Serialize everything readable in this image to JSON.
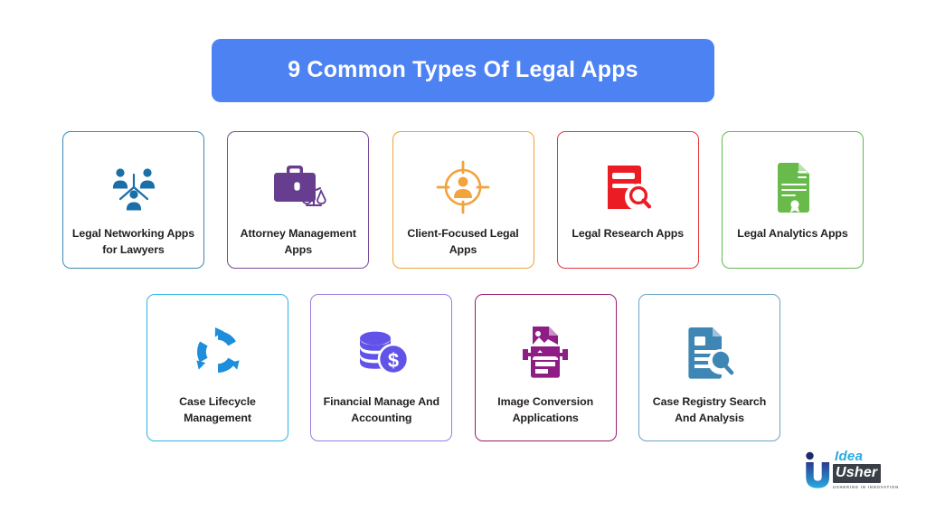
{
  "title": {
    "text": "9 Common Types Of Legal Apps",
    "background_color": "#4d82f3",
    "text_color": "#ffffff"
  },
  "rows": [
    {
      "id": "row-1",
      "cards": [
        {
          "label": "Legal Networking Apps for Lawyers",
          "icon": "people-network-icon",
          "border_color": "#3b8ab5",
          "icon_color": "#1a6fa8"
        },
        {
          "label": "Attorney Management Apps",
          "icon": "briefcase-scales-icon",
          "border_color": "#7a4a97",
          "icon_color": "#663d8f"
        },
        {
          "label": "Client-Focused Legal Apps",
          "icon": "target-person-icon",
          "border_color": "#eaa636",
          "icon_color": "#f2a33c"
        },
        {
          "label": "Legal Research Apps",
          "icon": "book-search-icon",
          "border_color": "#e8343c",
          "icon_color": "#ec1c24"
        },
        {
          "label": "Legal Analytics Apps",
          "icon": "certificate-document-icon",
          "border_color": "#63b94e",
          "icon_color": "#68bb4a"
        }
      ]
    },
    {
      "id": "row-2",
      "cards": [
        {
          "label": "Case Lifecycle Management",
          "icon": "circular-arrows-icon",
          "border_color": "#2eb4e8",
          "icon_color": "#1e8ddb"
        },
        {
          "label": "Financial Manage And Accounting",
          "icon": "coins-dollar-icon",
          "border_color": "#9a7de0",
          "icon_color": "#6153e8"
        },
        {
          "label": "Image Conversion Applications",
          "icon": "image-document-convert-icon",
          "border_color": "#9b1a6a",
          "icon_color": "#8e1e86"
        },
        {
          "label": "Case Registry Search And Analysis",
          "icon": "document-magnifier-icon",
          "border_color": "#6aa3c4",
          "icon_color": "#3e87b5"
        }
      ]
    }
  ],
  "logo": {
    "idea": "Idea",
    "usher": "Usher",
    "tagline": "USHERING IN INNOVATION",
    "mark_color_top": "#2b3a8f",
    "mark_color_bottom": "#29aae1"
  }
}
